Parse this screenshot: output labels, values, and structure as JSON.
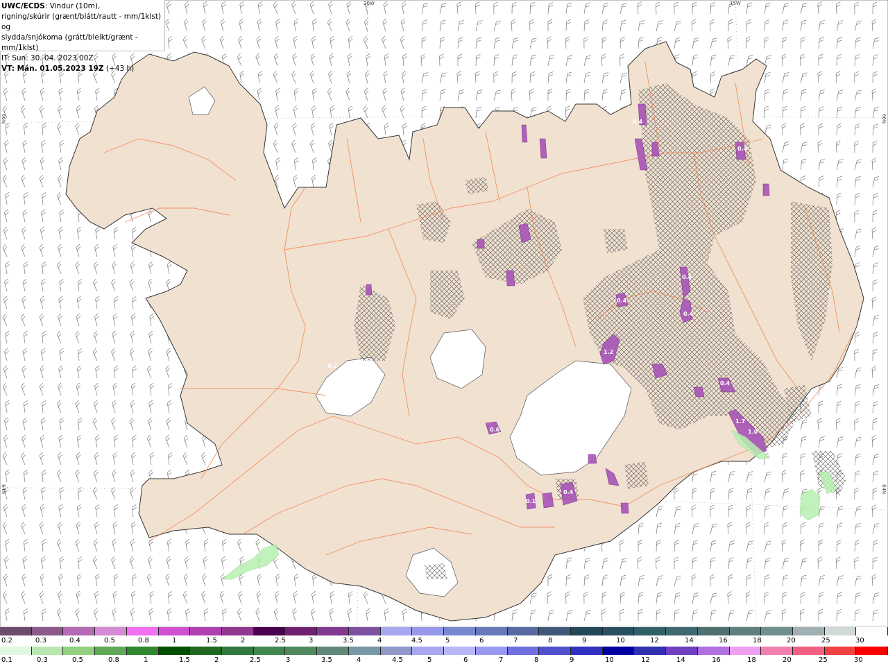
{
  "info": {
    "model": "UWC/ECDS",
    "line1": ": Vindur (10m),",
    "line2": "rigning/skúrir (grænt/blátt/rautt - mm/1klst) og",
    "line3": "slydda/snjókoma (grátt/bleikt/grænt - mm/1klst)",
    "it": "IT: Sun. 30. 04. 2023 00Z",
    "vt_bold": "VT: Mán. 01.05.2023 19Z",
    "vt_rest": " (+43 h)"
  },
  "graticule": {
    "lon_20w": "20W",
    "lon_15w": "15W",
    "lat_66n_left": "66N",
    "lat_66n_right": "66N",
    "lat_64n_left": "64N",
    "lat_64n_right": "64N"
  },
  "precip_values": [
    "1.2",
    "0.4",
    "0.4",
    "0.4",
    "0.4",
    "1.7",
    "1.0",
    "0.4",
    "0.4",
    "0.2",
    "0.4",
    "0.6",
    "0.1"
  ],
  "colors": {
    "land": "#f1e1d1",
    "glacier": "#ffffff",
    "roads": "#f08a55",
    "snow": "#a855b8",
    "rain": "#b8f0b0"
  },
  "scale_top": {
    "colors": [
      "#6b4c6b",
      "#8b5a8b",
      "#b46ab4",
      "#d48ad4",
      "#f070f0",
      "#d050d0",
      "#b040b0",
      "#903890",
      "#4a0050",
      "#702070",
      "#803890",
      "#8050a0",
      "#a8a8f0",
      "#9898e8",
      "#7888d0",
      "#6878b8",
      "#5868a0",
      "#405878",
      "#204858",
      "#285060",
      "#306068",
      "#406870",
      "#507070",
      "#608080",
      "#709090",
      "#a0b0b0",
      "#d0d8d8",
      "#ffffff"
    ],
    "labels": [
      "0.2",
      "0.3",
      "0.4",
      "0.5",
      "0.8",
      "1",
      "1.5",
      "2",
      "2.5",
      "3",
      "3.5",
      "4",
      "4.5",
      "5",
      "6",
      "7",
      "8",
      "9",
      "10",
      "12",
      "14",
      "16",
      "18",
      "20",
      "25",
      "30"
    ]
  },
  "scale_bottom": {
    "colors": [
      "#e0f8e0",
      "#b8e8b0",
      "#90d080",
      "#60a858",
      "#308830",
      "#005000",
      "#206820",
      "#307840",
      "#408850",
      "#508860",
      "#608878",
      "#7898a8",
      "#9098c8",
      "#a8a8f0",
      "#b8b8f8",
      "#9898f0",
      "#7070e0",
      "#5050d0",
      "#3030c0",
      "#0000a0",
      "#3030b0",
      "#7040c0",
      "#b070e0",
      "#f0a0f0",
      "#f080b0",
      "#f06080",
      "#f04040",
      "#ff0000"
    ],
    "labels": [
      "0.1",
      "0.3",
      "0.5",
      "0.8",
      "1",
      "1.5",
      "2",
      "2.5",
      "3",
      "3.5",
      "4",
      "4.5",
      "5",
      "6",
      "7",
      "8",
      "9",
      "10",
      "12",
      "14",
      "16",
      "18",
      "20",
      "25",
      "30"
    ]
  }
}
